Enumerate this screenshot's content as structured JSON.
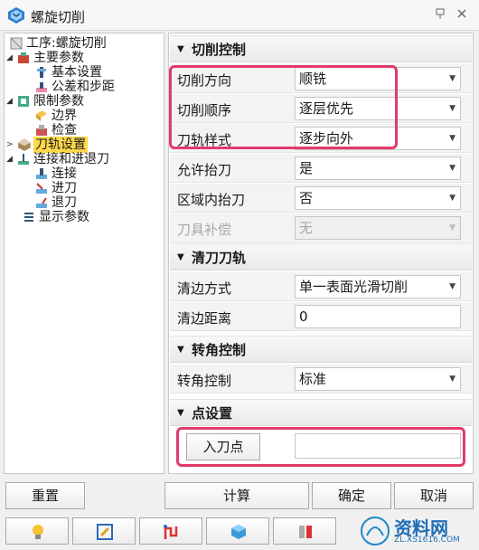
{
  "window": {
    "title": "螺旋切削",
    "pin_icon": "pin-icon",
    "close_icon": "close-icon"
  },
  "tree": {
    "items": [
      {
        "label": "工序:螺旋切削",
        "icon": "operation-icon"
      },
      {
        "label": "主要参数",
        "icon": "main-params-icon"
      },
      {
        "label": "基本设置",
        "icon": "basic-settings-icon"
      },
      {
        "label": "公差和步距",
        "icon": "tolerance-icon"
      },
      {
        "label": "限制参数",
        "icon": "limit-params-icon"
      },
      {
        "label": "边界",
        "icon": "boundary-icon"
      },
      {
        "label": "检查",
        "icon": "check-icon"
      },
      {
        "label": "刀轨设置",
        "icon": "toolpath-icon"
      },
      {
        "label": "连接和进退刀",
        "icon": "link-icon"
      },
      {
        "label": "连接",
        "icon": "connect-icon"
      },
      {
        "label": "进刀",
        "icon": "approach-icon"
      },
      {
        "label": "退刀",
        "icon": "retract-icon"
      },
      {
        "label": "显示参数",
        "icon": "display-icon"
      }
    ]
  },
  "sections": {
    "cutting": {
      "title": "切削控制",
      "rows": [
        {
          "label": "切削方向",
          "value": "顺铣"
        },
        {
          "label": "切削顺序",
          "value": "逐层优先"
        },
        {
          "label": "刀轨样式",
          "value": "逐步向外"
        },
        {
          "label": "允许抬刀",
          "value": "是"
        },
        {
          "label": "区域内抬刀",
          "value": "否"
        },
        {
          "label": "刀具补偿",
          "value": "无"
        }
      ]
    },
    "cleanup": {
      "title": "清刀刀轨",
      "rows": [
        {
          "label": "清边方式",
          "value": "单一表面光滑切削"
        },
        {
          "label": "清边距离",
          "value": "0"
        }
      ]
    },
    "corner": {
      "title": "转角控制",
      "rows": [
        {
          "label": "转角控制",
          "value": "标准"
        }
      ]
    },
    "point": {
      "title": "点设置",
      "entry_button": "入刀点",
      "entry_value": ""
    }
  },
  "buttons": {
    "reset": "重置",
    "compute": "计算",
    "ok": "确定",
    "cancel": "取消"
  },
  "toolbar_icons": [
    "bulb-icon",
    "edit-icon",
    "toolpath-preview-icon",
    "simulate-icon",
    "tool-icon"
  ],
  "watermark": {
    "text": "资料网",
    "url_text": "ZL.XS1616.COM"
  },
  "highlight_color": "#e23a6b",
  "selected_color": "#ffd84a"
}
